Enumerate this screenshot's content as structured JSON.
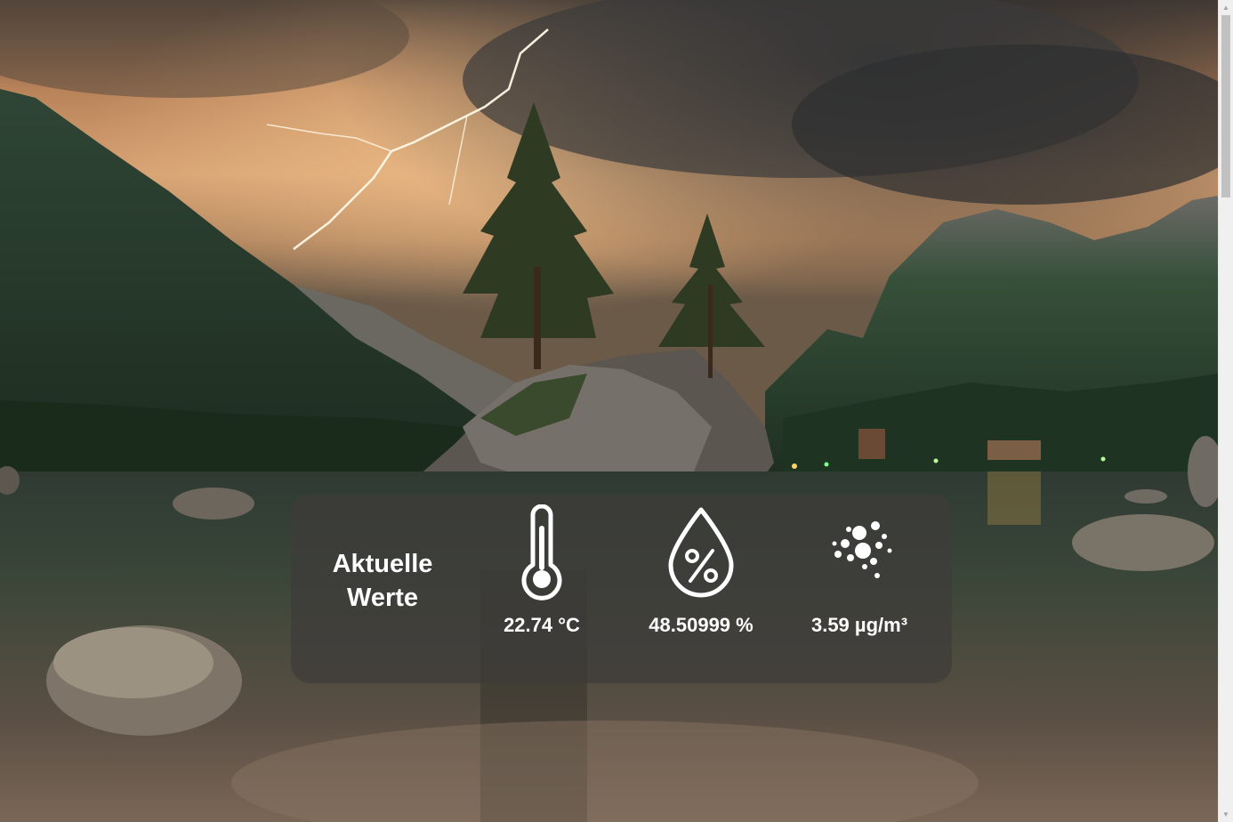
{
  "panel": {
    "title_line1": "Aktuelle",
    "title_line2": "Werte"
  },
  "metrics": [
    {
      "name": "temperature",
      "icon": "thermometer-icon",
      "value": "22.74 °C"
    },
    {
      "name": "humidity",
      "icon": "humidity-drop-percent-icon",
      "value": "48.50999 %"
    },
    {
      "name": "particulate-matter",
      "icon": "particles-icon",
      "value": "3.59 µg/m³"
    }
  ],
  "colors": {
    "panel_background": "#3e3c3a",
    "text": "#ffffff",
    "scrollbar_track": "#f0f0f0",
    "scrollbar_thumb": "#c1c1c1"
  }
}
